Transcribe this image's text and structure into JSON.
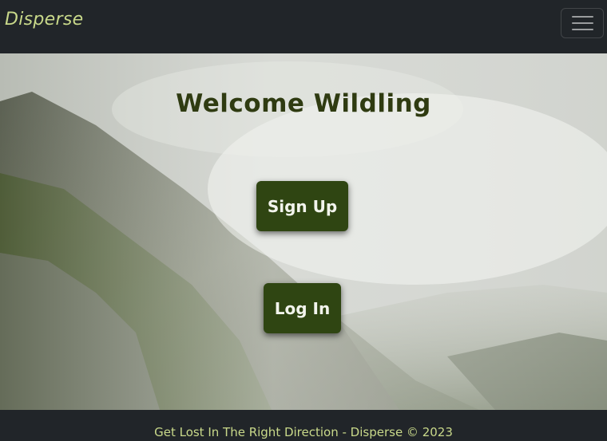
{
  "navbar": {
    "brand": "Disperse",
    "toggler_icon": "hamburger-icon"
  },
  "hero": {
    "title": "Welcome Wildling",
    "signup_label": "Sign Up",
    "login_label": "Log In",
    "background": "misty mountain slope photo"
  },
  "footer": {
    "text": "Get Lost In The Right Direction - Disperse © 2023"
  },
  "colors": {
    "navbar_bg": "#212529",
    "brand_color": "#c9d98a",
    "title_color": "#2f3b11",
    "button_bg": "#2f4512",
    "button_text": "#f2f4ec"
  }
}
